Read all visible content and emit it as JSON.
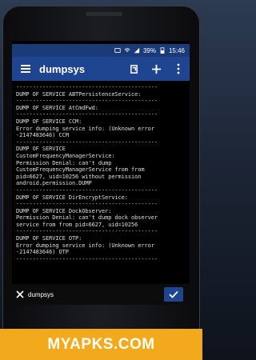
{
  "status_bar": {
    "battery_percent": "39%",
    "time": "15:46"
  },
  "app_bar": {
    "title": "dumpsys",
    "icons": [
      "menu-icon",
      "open-external-icon",
      "add-icon",
      "more-vert-icon"
    ]
  },
  "console": {
    "separator": "-------------------------------------------",
    "blocks": [
      [
        "DUMP OF SERVICE ABTPersistenceService:"
      ],
      [
        "DUMP OF SERVICE AtCmdFwd:"
      ],
      [
        "DUMP OF SERVICE CCM:",
        "Error dumping service info: (Unknown error",
        "-2147483646) CCM"
      ],
      [
        "DUMP OF SERVICE",
        "CustomFrequencyManagerService:",
        "Permission Denial: can't dump",
        "CustomFrequencyManagerService from from",
        "pid=6627, uid=10256 without permission",
        "android.permission.DUMP"
      ],
      [
        "DUMP OF SERVICE DirEncryptService:"
      ],
      [
        "DUMP OF SERVICE DockObserver:",
        "Permission Denial: can't dump dock observer",
        "service from from pid=6627, uid=10256"
      ],
      [
        "DUMP OF SERVICE OTP:",
        "Error dumping service info: (Unknown error",
        "-2147483646) OTP"
      ]
    ]
  },
  "command_bar": {
    "input_value": "dumpsys"
  },
  "watermark": {
    "text": "MYAPKS.COM"
  },
  "colors": {
    "app_bar": "#1f4590",
    "status_bar": "#1a3a78",
    "console_bg": "#000000",
    "watermark_bg": "#f2a91b"
  }
}
